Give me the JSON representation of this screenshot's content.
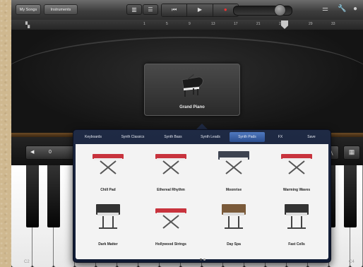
{
  "toolbar": {
    "my_songs": "My Songs",
    "instruments": "Instruments"
  },
  "ruler": [
    "1",
    "5",
    "9",
    "13",
    "17",
    "21",
    "25",
    "29",
    "33"
  ],
  "instrument": {
    "name": "Grand Piano"
  },
  "octave": {
    "value": "0"
  },
  "keys": {
    "left_label": "C2",
    "right_label": "C4"
  },
  "popover": {
    "tabs": [
      "Keyboards",
      "Synth Classics",
      "Synth Bass",
      "Synth Leads",
      "Synth Pads",
      "FX",
      "Save"
    ],
    "active_tab": "Synth Pads",
    "presets": [
      "Chill Pad",
      "Ethereal Rhythm",
      "Moonrise",
      "Warming Waves",
      "Dark Matter",
      "Hollywood Strings",
      "Day Spa",
      "Fast Cells"
    ]
  }
}
